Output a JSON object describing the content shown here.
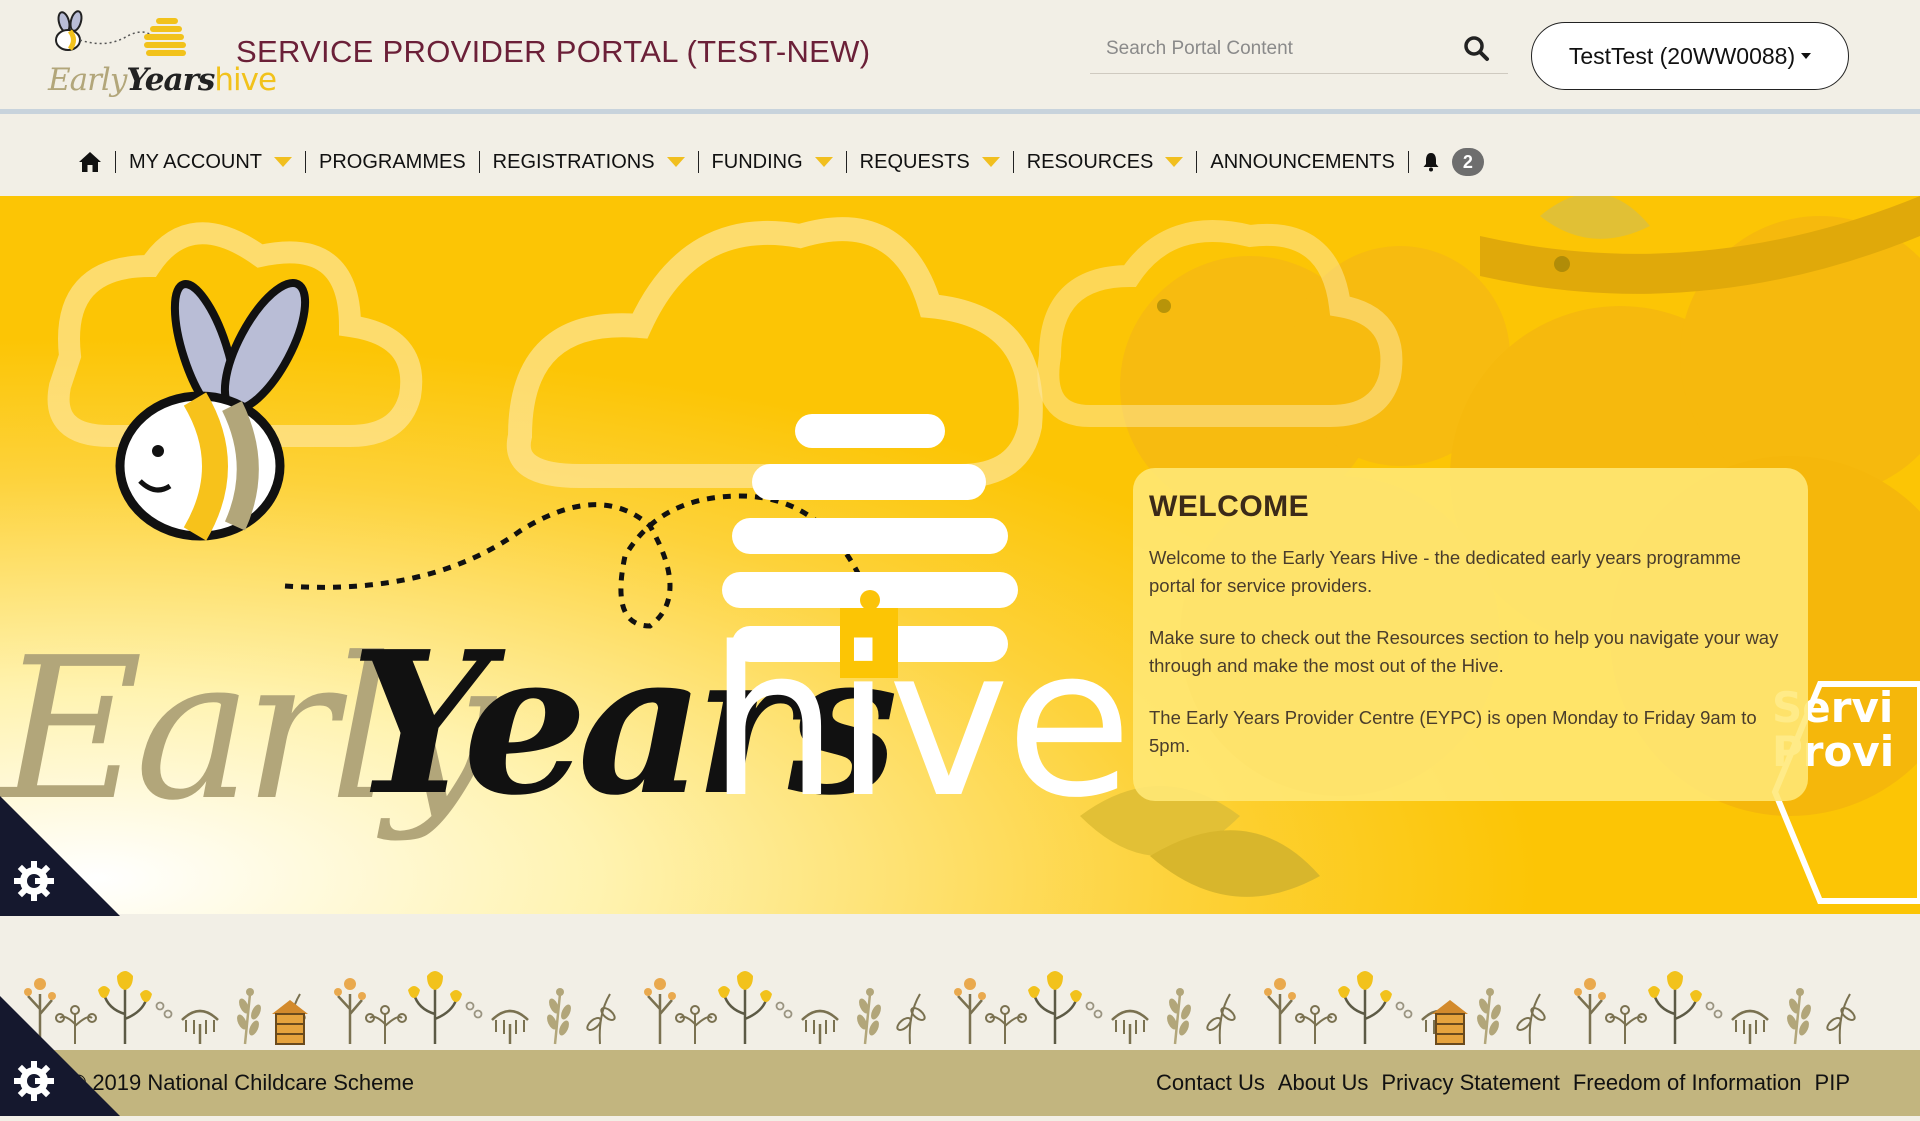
{
  "header": {
    "logo": {
      "early": "Early",
      "years": "Years",
      "hive": "hive"
    },
    "portal_title": "SERVICE PROVIDER PORTAL (TEST-NEW)",
    "search_placeholder": "Search Portal Content",
    "account_label": "TestTest (20WW0088)"
  },
  "nav": {
    "home_icon": "home-icon",
    "items": [
      {
        "label": "MY ACCOUNT",
        "dropdown": true
      },
      {
        "label": "PROGRAMMES",
        "dropdown": false
      },
      {
        "label": "REGISTRATIONS",
        "dropdown": true
      },
      {
        "label": "FUNDING",
        "dropdown": true
      },
      {
        "label": "REQUESTS",
        "dropdown": true
      },
      {
        "label": "RESOURCES",
        "dropdown": true
      },
      {
        "label": "ANNOUNCEMENTS",
        "dropdown": false
      }
    ],
    "notifications_icon": "bell-icon",
    "notifications_count": "2"
  },
  "hero": {
    "brand": {
      "early": "Early",
      "years": "Years",
      "hive": "hive"
    },
    "side_tag": [
      "Servi",
      "Provi"
    ],
    "welcome": {
      "title": "WELCOME",
      "paragraphs": [
        "Welcome to the Early Years Hive - the dedicated early years programme portal for service providers.",
        "Make sure to check out the Resources section to help you navigate your way through and make the most out of the Hive.",
        "The Early Years Provider Centre (EYPC) is open Monday to Friday 9am to 5pm."
      ]
    }
  },
  "footer": {
    "copyright": "© 2019 National Childcare Scheme",
    "links": [
      "Contact Us",
      "About Us",
      "Privacy Statement",
      "Freedom of Information",
      "PIP"
    ]
  },
  "cookie_icon": "cookie-settings-icon",
  "colors": {
    "title": "#6b2038",
    "hero_yellow": "#fcc505",
    "accent_yellow": "#f1bf1f",
    "footer_bg": "#c2b57f",
    "page_bg": "#f2efe6"
  }
}
